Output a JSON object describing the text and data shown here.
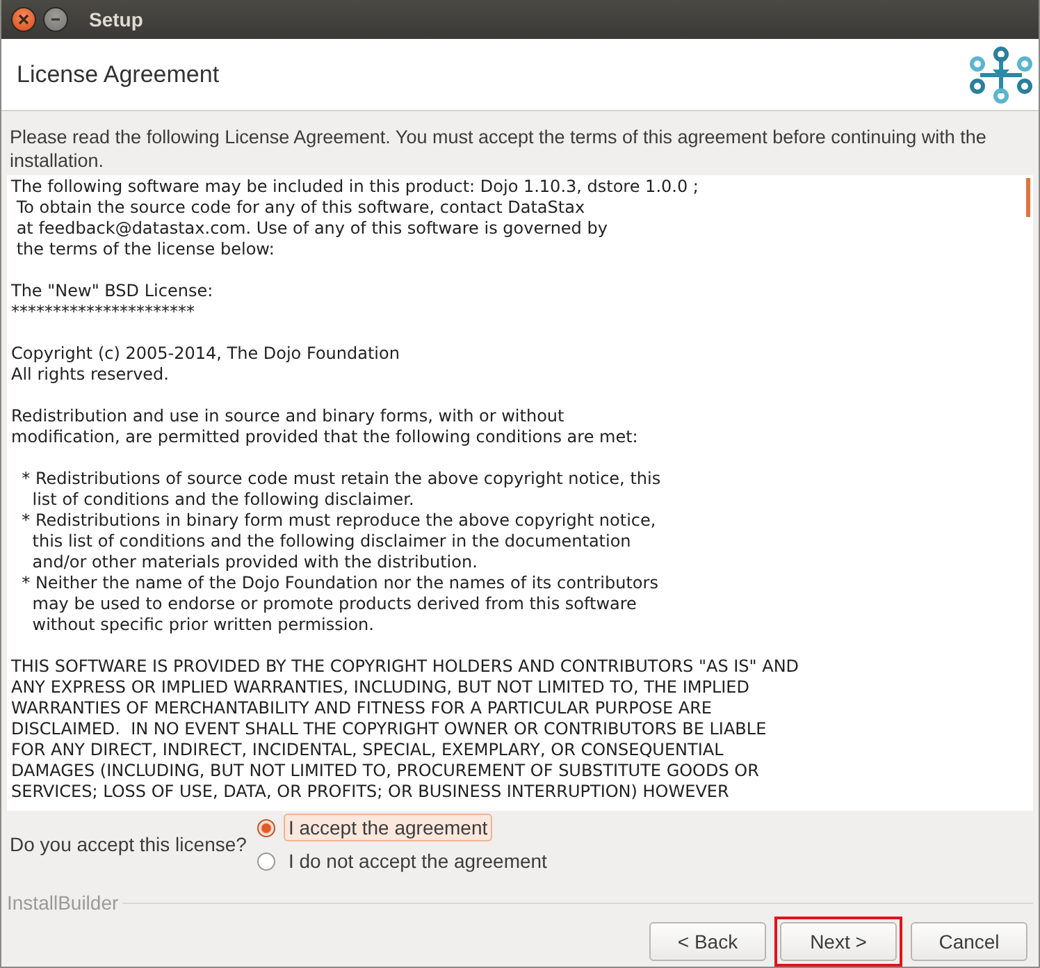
{
  "window": {
    "title": "Setup",
    "controls": [
      {
        "kind": "close"
      },
      {
        "kind": "minimize"
      }
    ]
  },
  "header": {
    "title": "License Agreement"
  },
  "intro": "Please read the following License Agreement. You must accept the terms of this agreement before continuing with the installation.",
  "license_paragraphs": [
    "The following software may be included in this product: Dojo 1.10.3, dstore 1.0.0 ;\n To obtain the source code for any of this software, contact DataStax\n at feedback@datastax.com. Use of any of this software is governed by\n the terms of the license below:",
    "The \"New\" BSD License:\n**********************",
    "Copyright (c) 2005-2014, The Dojo Foundation\nAll rights reserved.",
    "Redistribution and use in source and binary forms, with or without\nmodification, are permitted provided that the following conditions are met:",
    "  * Redistributions of source code must retain the above copyright notice, this\n    list of conditions and the following disclaimer.\n  * Redistributions in binary form must reproduce the above copyright notice,\n    this list of conditions and the following disclaimer in the documentation\n    and/or other materials provided with the distribution.\n  * Neither the name of the Dojo Foundation nor the names of its contributors\n    may be used to endorse or promote products derived from this software\n    without specific prior written permission.",
    "THIS SOFTWARE IS PROVIDED BY THE COPYRIGHT HOLDERS AND CONTRIBUTORS \"AS IS\" AND\nANY EXPRESS OR IMPLIED WARRANTIES, INCLUDING, BUT NOT LIMITED TO, THE IMPLIED\nWARRANTIES OF MERCHANTABILITY AND FITNESS FOR A PARTICULAR PURPOSE ARE\nDISCLAIMED.  IN NO EVENT SHALL THE COPYRIGHT OWNER OR CONTRIBUTORS BE LIABLE\nFOR ANY DIRECT, INDIRECT, INCIDENTAL, SPECIAL, EXEMPLARY, OR CONSEQUENTIAL\nDAMAGES (INCLUDING, BUT NOT LIMITED TO, PROCUREMENT OF SUBSTITUTE GOODS OR\nSERVICES; LOSS OF USE, DATA, OR PROFITS; OR BUSINESS INTERRUPTION) HOWEVER"
  ],
  "question": {
    "label": "Do you accept this license?",
    "options": [
      {
        "label": "I accept the agreement",
        "selected": true
      },
      {
        "label": "I do not accept the agreement",
        "selected": false
      }
    ]
  },
  "footer": {
    "brand": "InstallBuilder"
  },
  "buttons": [
    {
      "label": "< Back",
      "highlighted": false
    },
    {
      "label": "Next >",
      "highlighted": true
    },
    {
      "label": "Cancel",
      "highlighted": false
    }
  ]
}
